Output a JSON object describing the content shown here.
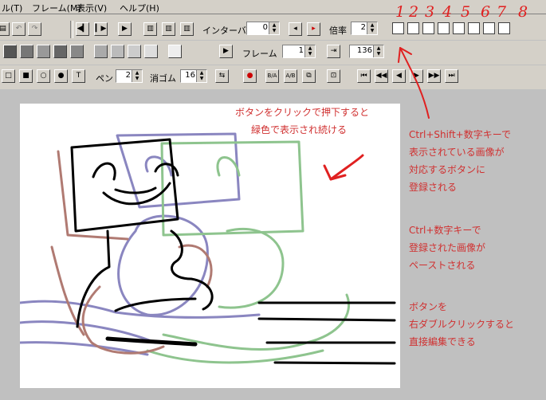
{
  "menu": {
    "items": [
      "ル(T)",
      "フレーム(M)",
      "表示(V)",
      "ヘルプ(H)"
    ]
  },
  "toolbar1": {
    "interval_label": "インターバル",
    "interval_value": "0",
    "ratio_label": "倍率",
    "ratio_value": "2"
  },
  "toolbar2": {
    "frame_label": "フレーム",
    "frame_value": "1",
    "frame_total": "136"
  },
  "toolbar3": {
    "pen_label": "ペン",
    "pen_value": "2",
    "eraser_label": "消ゴム",
    "eraser_value": "16",
    "ratio_a": "B/A",
    "ratio_b": "A/B"
  },
  "slot_numbers": [
    "1",
    "2",
    "3",
    "4",
    "5",
    "6",
    "7",
    "8"
  ],
  "annotations": {
    "top_line1": "ボタンをクリックで押下すると",
    "top_line2": "緑色で表示され続ける",
    "reg_lines": [
      "Ctrl+Shift+数字キーで",
      "表示されている画像が",
      "対応するボタンに",
      "登録される"
    ],
    "paste_lines": [
      "Ctrl+数字キーで",
      "登録された画像が",
      "ペーストされる"
    ],
    "edit_lines": [
      "ボタンを",
      "右ダブルクリックすると",
      "直接編集できる"
    ]
  },
  "colors": {
    "annotation": "#d03030",
    "green_layer": "#8ec48e",
    "blue_layer": "#8a86c0",
    "red_layer": "#b07a72"
  }
}
